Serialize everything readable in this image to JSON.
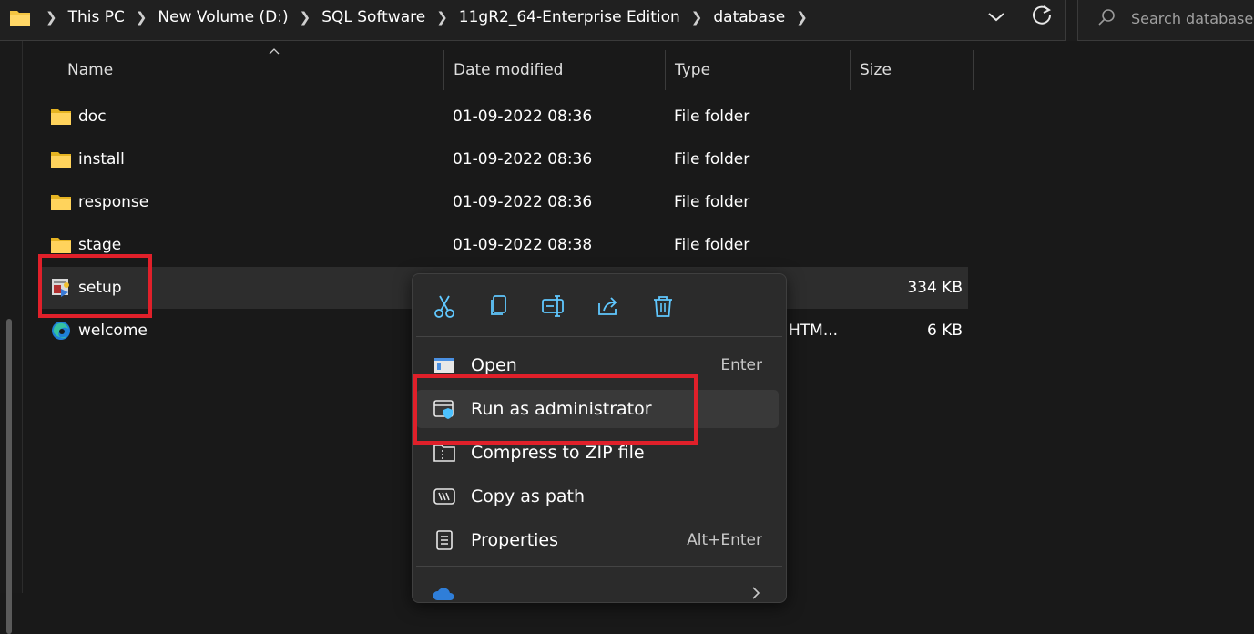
{
  "address_bar": {
    "breadcrumbs": [
      "This PC",
      "New Volume (D:)",
      "SQL Software",
      "11gR2_64-Enterprise Edition",
      "database"
    ],
    "search_placeholder": "Search database"
  },
  "columns": {
    "name": "Name",
    "date_modified": "Date modified",
    "type": "Type",
    "size": "Size"
  },
  "files": [
    {
      "name": "doc",
      "date": "01-09-2022 08:36",
      "type": "File folder",
      "size": "",
      "icon": "folder-icon"
    },
    {
      "name": "install",
      "date": "01-09-2022 08:36",
      "type": "File folder",
      "size": "",
      "icon": "folder-icon"
    },
    {
      "name": "response",
      "date": "01-09-2022 08:36",
      "type": "File folder",
      "size": "",
      "icon": "folder-icon"
    },
    {
      "name": "stage",
      "date": "01-09-2022 08:38",
      "type": "File folder",
      "size": "",
      "icon": "folder-icon"
    },
    {
      "name": "setup",
      "date": "",
      "type": "",
      "size": "334 KB",
      "icon": "setup-exe-icon",
      "selected": true
    },
    {
      "name": "welcome",
      "date": "",
      "type": "HTM...",
      "size": "6 KB",
      "icon": "edge-html-icon"
    }
  ],
  "context_menu": {
    "quick_actions": [
      "cut-icon",
      "copy-icon",
      "rename-icon",
      "share-icon",
      "delete-icon"
    ],
    "items": [
      {
        "label": "Open",
        "shortcut": "Enter",
        "icon": "open-app-icon"
      },
      {
        "label": "Run as administrator",
        "shortcut": "",
        "icon": "shield-admin-icon",
        "hovered": true
      },
      {
        "label": "Compress to ZIP file",
        "shortcut": "",
        "icon": "zip-folder-icon"
      },
      {
        "label": "Copy as path",
        "shortcut": "",
        "icon": "copy-path-icon"
      },
      {
        "label": "Properties",
        "shortcut": "Alt+Enter",
        "icon": "properties-icon"
      }
    ]
  },
  "colors": {
    "background": "#191919",
    "menu_bg": "#2b2b2b",
    "selected_row": "#2d2d2d",
    "highlight_red": "#e0202a",
    "folder_yellow": "#f4c542",
    "accent_blue": "#4cc2ff"
  }
}
